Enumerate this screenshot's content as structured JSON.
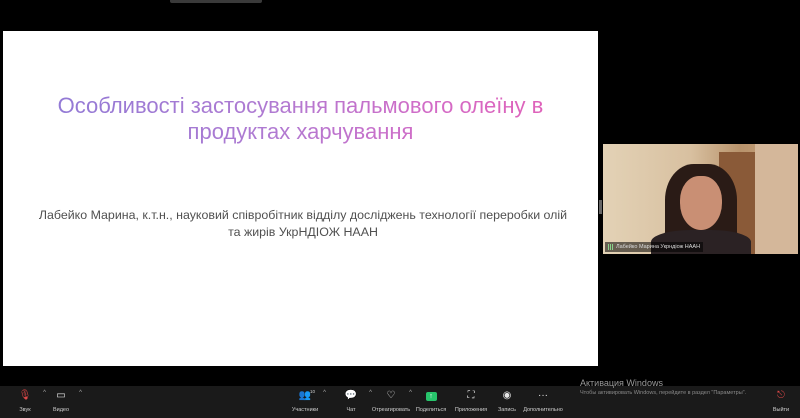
{
  "slide": {
    "title": "Особливості застосування пальмового олеїну в продуктах харчування",
    "author": "Лабейко Марина, к.т.н.,  науковий співробітник відділу досліджень технології переробки олій та жирів УкрНДІОЖ НААН"
  },
  "video": {
    "participant_name": "Лабейко Марина Укрндіож НААН"
  },
  "toolbar": {
    "audio_label": "Звук",
    "video_label": "Видео",
    "participants_label": "Участники",
    "participants_count": "10",
    "chat_label": "Чат",
    "reactions_label": "Отреагировать",
    "share_label": "Поделиться",
    "whiteboard_label": "Приложения",
    "record_label": "Запись",
    "more_label": "Дополнительно",
    "leave_label": "Выйти"
  },
  "watermark": {
    "title": "Активация Windows",
    "subtitle": "Чтобы активировать Windows, перейдите в раздел \"Параметры\"."
  },
  "colors": {
    "title_gradient_start": "#8e7ad6",
    "title_gradient_end": "#e25fb6",
    "share_green": "#27c46b",
    "mic_red": "#e04848"
  }
}
